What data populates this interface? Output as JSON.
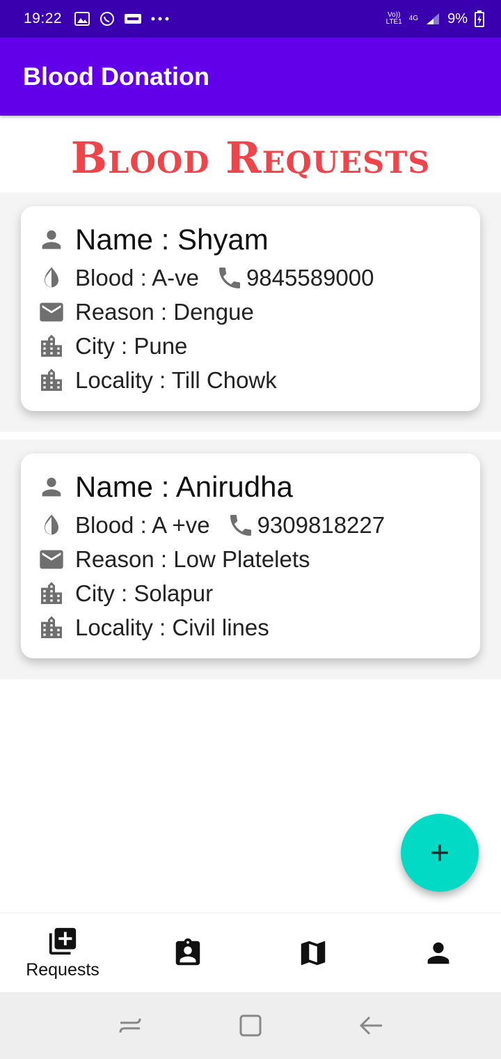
{
  "status_bar": {
    "time": "19:22",
    "carrier_tag_top": "Vo))",
    "carrier_tag_bottom": "LTE1",
    "network": "4G",
    "battery": "9%"
  },
  "app_bar": {
    "title": "Blood Donation"
  },
  "heading": "Blood Requests",
  "requests": [
    {
      "name": "Name : Shyam",
      "blood": "Blood : A-ve",
      "phone": "9845589000",
      "reason": "Reason : Dengue",
      "city": "City : Pune",
      "locality": "Locality : Till Chowk"
    },
    {
      "name": "Name : Anirudha",
      "blood": "Blood : A +ve",
      "phone": "9309818227",
      "reason": "Reason : Low Platelets",
      "city": "City : Solapur",
      "locality": "Locality : Civil lines"
    }
  ],
  "bottom_nav": {
    "requests_label": "Requests"
  },
  "colors": {
    "app_bar": "#6200ea",
    "status_bar": "#3a00b0",
    "heading": "#f0444b",
    "fab": "#03dac5"
  }
}
